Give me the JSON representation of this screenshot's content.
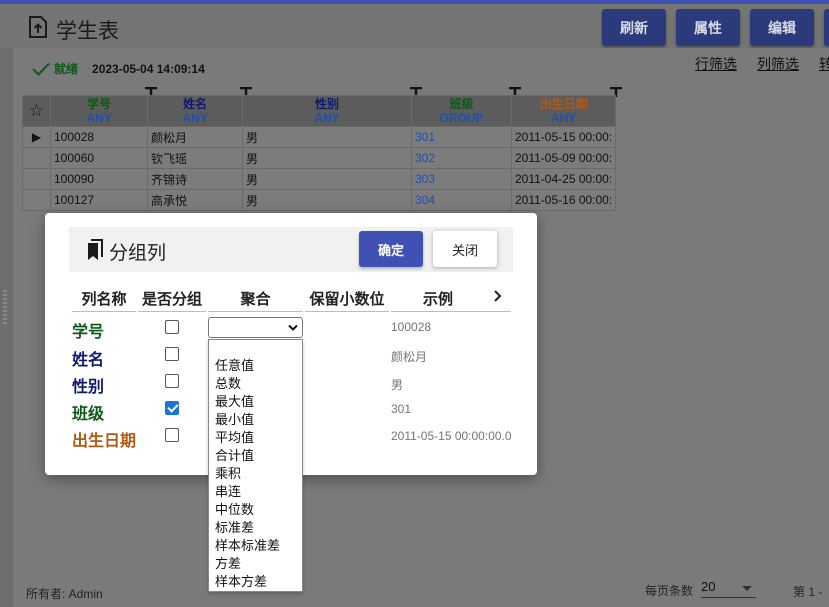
{
  "app": {
    "title": "学生表",
    "buttons": [
      {
        "label": "刷新"
      },
      {
        "label": "属性"
      },
      {
        "label": "编辑"
      }
    ]
  },
  "status": {
    "text": "就绪",
    "timestamp": "2023-05-04 14:09:14"
  },
  "top_links": [
    "行筛选",
    "列筛选",
    "转"
  ],
  "grid": {
    "columns": [
      {
        "name": "学号",
        "sub": "ANY",
        "color": "#0b5a16"
      },
      {
        "name": "姓名",
        "sub": "ANY",
        "color": "#0d1a6e"
      },
      {
        "name": "性别",
        "sub": "ANY",
        "color": "#0d1a6e"
      },
      {
        "name": "班级",
        "sub": "GROUP",
        "color": "#0b5a16"
      },
      {
        "name": "出生日期",
        "sub": "ANY",
        "color": "#b35a10"
      }
    ],
    "rows": [
      [
        "100028",
        "颜松月",
        "男",
        "301",
        "2011-05-15 00:00:"
      ],
      [
        "100060",
        "钦飞瑶",
        "男",
        "302",
        "2011-05-09 00:00:"
      ],
      [
        "100090",
        "齐锦诗",
        "男",
        "303",
        "2011-04-25 00:00:"
      ],
      [
        "100127",
        "高承悦",
        "男",
        "304",
        "2011-05-16 00:00:"
      ]
    ],
    "sub_color": "#1e4fb0",
    "link_color": "#1e4fb0"
  },
  "footer": {
    "owner": "所有者: Admin",
    "per_page_label": "每页条数",
    "per_page_value": "20",
    "page_text": "第 1 -"
  },
  "dialog": {
    "title": "分组列",
    "ok_label": "确定",
    "close_label": "关闭",
    "headers": [
      "列名称",
      "是否分组",
      "聚合",
      "保留小数位",
      "示例"
    ],
    "fields": [
      {
        "name": "学号",
        "color": "#0b5a16",
        "grouped": false,
        "example": "100028"
      },
      {
        "name": "姓名",
        "color": "#0d1a6e",
        "grouped": false,
        "example": "颜松月"
      },
      {
        "name": "性别",
        "color": "#0d1a6e",
        "grouped": false,
        "example": "男"
      },
      {
        "name": "班级",
        "color": "#0b5a16",
        "grouped": true,
        "example": "301"
      },
      {
        "name": "出生日期",
        "color": "#b35a10",
        "grouped": false,
        "example": "2011-05-15 00:00:00.0"
      }
    ],
    "aggregate_options": [
      "",
      "任意值",
      "总数",
      "最大值",
      "最小值",
      "平均值",
      "合计值",
      "乘积",
      "串连",
      "中位数",
      "标准差",
      "样本标准差",
      "方差",
      "样本方差"
    ]
  }
}
